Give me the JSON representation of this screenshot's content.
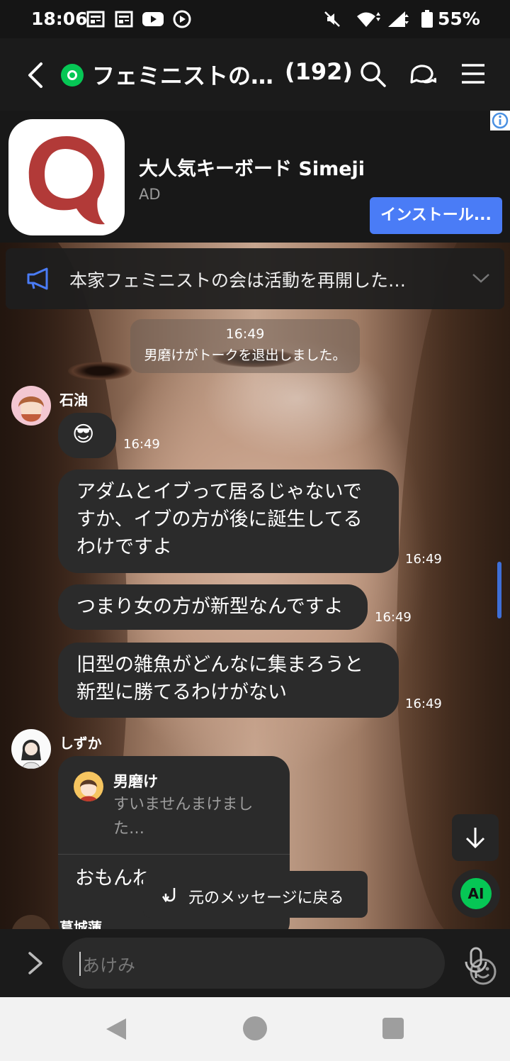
{
  "status_bar": {
    "time": "18:06",
    "battery": "55%",
    "icons": [
      "news-icon",
      "news-icon",
      "youtube-icon",
      "media-icon",
      "mute-icon",
      "wifi-icon",
      "signal-icon",
      "battery-icon"
    ]
  },
  "header": {
    "title": "フェミニストの…",
    "member_count": "(192)",
    "icons": [
      "back-arrow-icon",
      "openchat-icon",
      "search-icon",
      "chat-bubbles-icon",
      "menu-icon"
    ]
  },
  "ad": {
    "app_name": "大人気キーボード Simeji",
    "ad_label": "AD",
    "install_label": "インストール...",
    "brand_color": "#b23a38",
    "button_color": "#4a7cf6"
  },
  "announcement": {
    "text": "本家フェミニストの会は活動を再開した…"
  },
  "system_message": {
    "time": "16:49",
    "text": "男磨けがトークを退出しました。"
  },
  "messages": [
    {
      "sender": "石油",
      "text": "😎",
      "time": "16:49"
    },
    {
      "sender": "",
      "text": "アダムとイブって居るじゃないですか、イブの方が後に誕生してるわけですよ",
      "time": "16:49"
    },
    {
      "sender": "",
      "text": "つまり女の方が新型なんですよ",
      "time": "16:49"
    },
    {
      "sender": "",
      "text": "旧型の雑魚がどんなに集まろうと新型に勝てるわけがない",
      "time": "16:49"
    }
  ],
  "reply_message": {
    "sender": "しずか",
    "quoted_name": "男磨け",
    "quoted_text": "すいませんまけました…",
    "body": "おもんね"
  },
  "back_to_message": "元のメッセージに戻る",
  "next_sender": "葛城蓮",
  "ai_button": "AI",
  "input": {
    "placeholder": "あけみ"
  },
  "accent_green": "#06c755"
}
